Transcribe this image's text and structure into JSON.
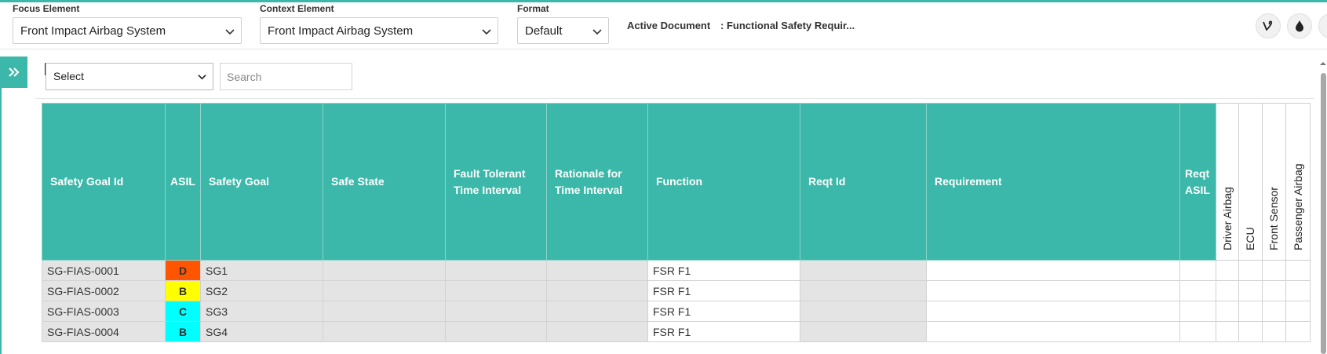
{
  "header": {
    "focus_label": "Focus Element",
    "focus_value": "Front Impact Airbag System",
    "context_label": "Context Element",
    "context_value": "Front Impact Airbag System",
    "format_label": "Format",
    "format_value": "Default",
    "active_doc_label": "Active Document",
    "active_doc_value": ": Functional Safety Requir...",
    "icons": [
      "vine-icon",
      "drop-icon",
      "partial-round-icon"
    ]
  },
  "toolbar": {
    "filter_value": "Select",
    "search_placeholder": "Search"
  },
  "table": {
    "headers": {
      "goal_id": "Safety Goal Id",
      "asil": "ASIL",
      "goal": "Safety Goal",
      "safe_state": "Safe State",
      "ftti": "Fault Tolerant Time Interval",
      "rationale": "Rationale for Time Interval",
      "function": "Function",
      "reqt_id": "Reqt Id",
      "requirement": "Requirement",
      "reqt_asil": "Reqt ASIL",
      "driver_airbag": "Driver Airbag",
      "ecu": "ECU",
      "front_sensor": "Front Sensor",
      "passenger_airbag": "Passenger Airbag"
    },
    "rows": [
      {
        "goal_id": "SG-FIAS-0001",
        "asil": "D",
        "asil_color": "#ff5500",
        "goal": "SG1",
        "function": "FSR F1"
      },
      {
        "goal_id": "SG-FIAS-0002",
        "asil": "B",
        "asil_color": "#ffff00",
        "goal": "SG2",
        "function": "FSR F1"
      },
      {
        "goal_id": "SG-FIAS-0003",
        "asil": "C",
        "asil_color": "#00ffff",
        "goal": "SG3",
        "function": "FSR F1"
      },
      {
        "goal_id": "SG-FIAS-0004",
        "asil": "B",
        "asil_color": "#00ffff",
        "goal": "SG4",
        "function": "FSR F1"
      }
    ]
  },
  "colors": {
    "accent": "#3bb8a9",
    "function_text": "#2e8b2e",
    "readonly_cell": "#e4e4e4"
  }
}
